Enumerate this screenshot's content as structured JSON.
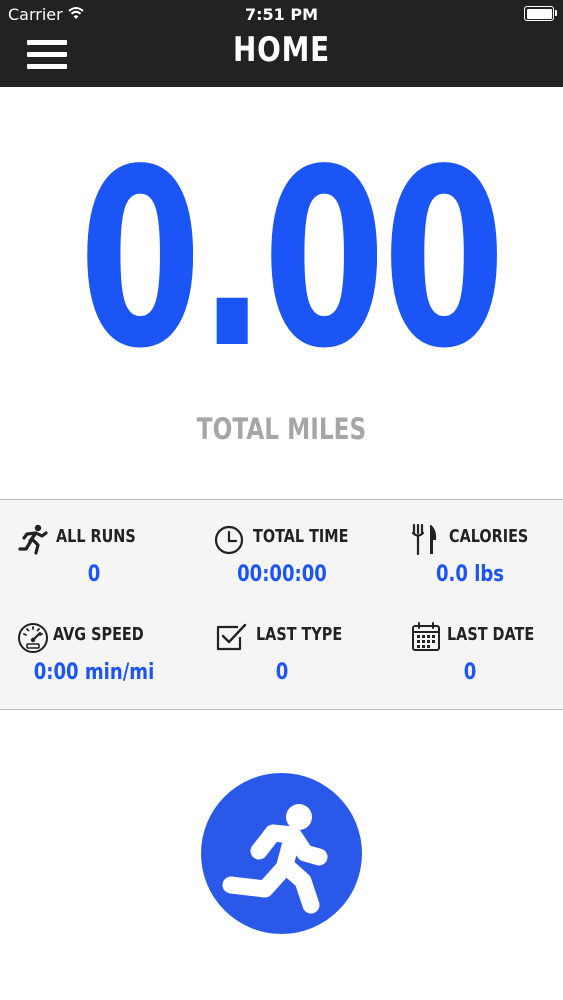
{
  "status_bar": {
    "carrier": "Carrier",
    "time": "7:51 PM"
  },
  "header": {
    "title": "HOME",
    "menu_icon": "hamburger-menu-icon"
  },
  "summary": {
    "value": "0.00",
    "label": "TOTAL MILES"
  },
  "stats": {
    "all_runs": {
      "label": "ALL RUNS",
      "value": "0",
      "icon": "runner-icon"
    },
    "total_time": {
      "label": "TOTAL TIME",
      "value": "00:00:00",
      "icon": "clock-icon"
    },
    "calories": {
      "label": "CALORIES",
      "value": "0.0 lbs",
      "icon": "fork-knife-icon"
    },
    "avg_speed": {
      "label": "AVG SPEED",
      "value": "0:00 min/mi",
      "icon": "speedometer-icon"
    },
    "last_type": {
      "label": "LAST TYPE",
      "value": "0",
      "icon": "checkbox-icon"
    },
    "last_date": {
      "label": "LAST DATE",
      "value": "0",
      "icon": "calendar-icon"
    }
  },
  "run_button": {
    "icon": "running-person-icon"
  },
  "colors": {
    "accent": "#1c55f6",
    "button": "#2a59ea",
    "header_bg": "#222222",
    "label_gray": "#a6a6a6",
    "panel_bg": "#f5f5f5"
  }
}
